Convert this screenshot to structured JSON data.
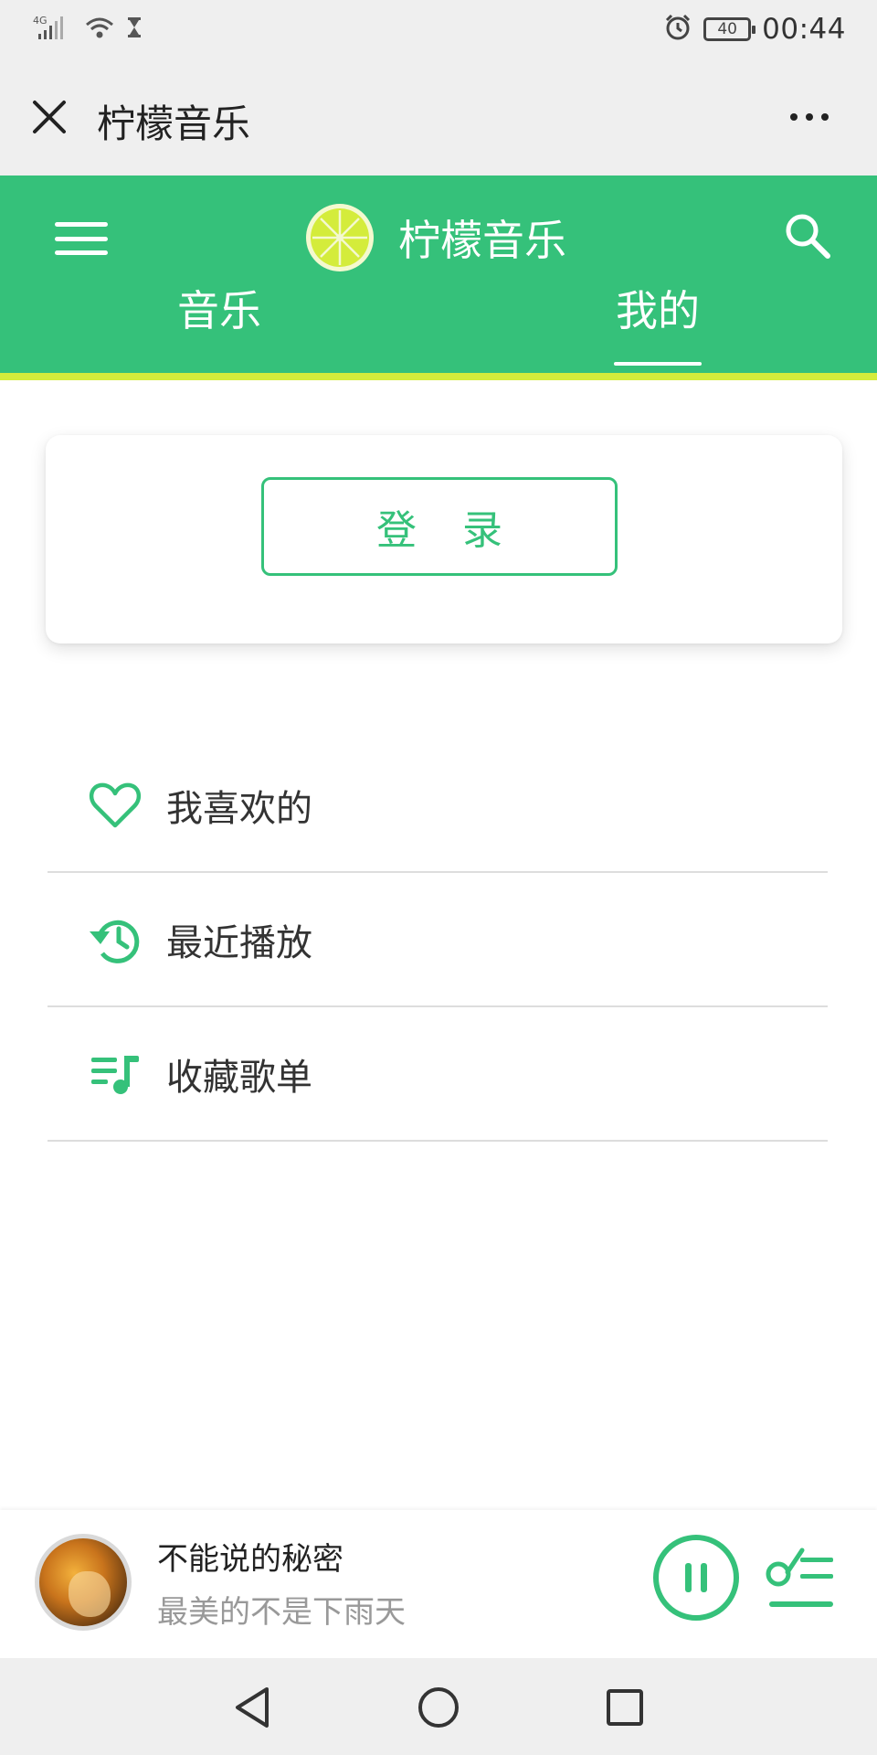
{
  "status_bar": {
    "network": "4G",
    "battery": "40",
    "time": "00:44",
    "icons": [
      "signal-icon",
      "wifi-icon",
      "hourglass-icon",
      "alarm-icon",
      "battery-icon"
    ]
  },
  "titlebar": {
    "title": "柠檬音乐",
    "close_icon": "close-icon",
    "more_icon": "more-icon"
  },
  "header": {
    "brand_title": "柠檬音乐",
    "tabs": [
      {
        "label": "音乐",
        "active": false
      },
      {
        "label": "我的",
        "active": true
      }
    ],
    "colors": {
      "primary": "#35c17a",
      "accent_line": "#d4ec3b",
      "lemon": "#d4ec3b"
    }
  },
  "login": {
    "button_label": "登 录"
  },
  "menu": {
    "items": [
      {
        "label": "我喜欢的",
        "icon": "heart-icon"
      },
      {
        "label": "最近播放",
        "icon": "history-icon"
      },
      {
        "label": "收藏歌单",
        "icon": "playlist-music-icon"
      }
    ]
  },
  "player": {
    "song_title": "不能说的秘密",
    "artist": "最美的不是下雨天",
    "state": "playing",
    "progress": 0.02
  },
  "nav": {
    "icons": [
      "back-icon",
      "home-icon",
      "recent-apps-icon"
    ]
  }
}
